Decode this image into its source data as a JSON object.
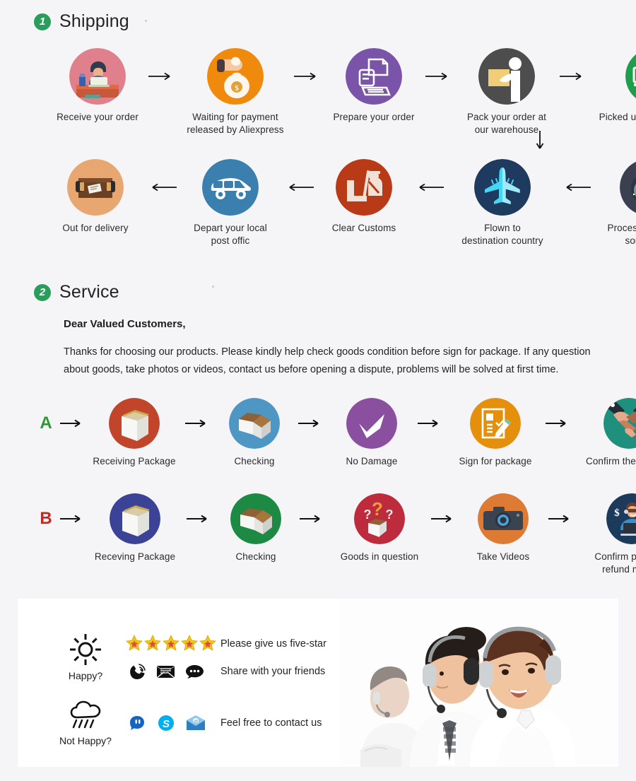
{
  "page": {
    "background": "#f5f4f6",
    "accent_green": "#2a9d5c"
  },
  "sections": [
    {
      "number": "1",
      "title": "Shipping"
    },
    {
      "number": "2",
      "title": "Service"
    }
  ],
  "shipping": {
    "row1": [
      {
        "label": "Receive your order",
        "icon": "desk-worker-icon",
        "color": "#e0808c"
      },
      {
        "label": "Waiting for payment\nreleased by Aliexpress",
        "icon": "money-bag-hand-icon",
        "color": "#ef8a0c"
      },
      {
        "label": "Prepare your order",
        "icon": "printer-icon",
        "color": "#7a54a8"
      },
      {
        "label": "Pack your order at\nour warehouse",
        "icon": "packing-worker-icon",
        "color": "#4d4d4d"
      },
      {
        "label": "Picked up by mail service",
        "icon": "delivery-truck-icon",
        "color": "#1d9e4b"
      }
    ],
    "row2": [
      {
        "label": "Out for delivery",
        "icon": "parcel-box-icon",
        "color": "#e8a671"
      },
      {
        "label": "Depart your local\npost offic",
        "icon": "delivery-van-icon",
        "color": "#3b7fae"
      },
      {
        "label": "Clear  Customs",
        "icon": "customs-officer-icon",
        "color": "#b83a17"
      },
      {
        "label": "Flown to\ndestination country",
        "icon": "airplane-icon",
        "color": "#1f3a5f"
      },
      {
        "label": "Processed through\nsort facility",
        "icon": "sort-facility-icon",
        "color": "#3a4050"
      }
    ],
    "arrow_right": "arrow-right-icon",
    "arrow_left": "arrow-left-icon",
    "arrow_down": "arrow-down-icon"
  },
  "service": {
    "salutation": "Dear Valued Customers,",
    "body": "Thanks for choosing our products. Please kindly help check goods condition before sign for package. If any question about goods, take photos or videos, contact us before opening a dispute, problems will be solved at first time.",
    "rowA": {
      "letter": "A",
      "letter_color": "#2c9a33",
      "steps": [
        {
          "label": "Receiving Package",
          "icon": "sealed-box-icon",
          "color": "#c1452b"
        },
        {
          "label": "Checking",
          "icon": "open-box-icon",
          "color": "#4e96c4"
        },
        {
          "label": "No Damage",
          "icon": "check-mark-icon",
          "color": "#8a4f9e"
        },
        {
          "label": "Sign for package",
          "icon": "sign-document-icon",
          "color": "#e5900d"
        },
        {
          "label": "Confirm the delivery",
          "icon": "handshake-icon",
          "color": "#1f8f7e"
        }
      ]
    },
    "rowB": {
      "letter": "B",
      "letter_color": "#c12a21",
      "steps": [
        {
          "label": "Receving Package",
          "icon": "sealed-box-icon",
          "color": "#3b4397"
        },
        {
          "label": "Checking",
          "icon": "open-box-icon",
          "color": "#1d8a43"
        },
        {
          "label": "Goods in question",
          "icon": "question-box-icon",
          "color": "#bd2b3c"
        },
        {
          "label": "Take Videos",
          "icon": "camera-icon",
          "color": "#dd7a34"
        },
        {
          "label": "Confirm problem,\nrefund money",
          "icon": "support-agent-money-icon",
          "color": "#1b3a5c"
        }
      ]
    }
  },
  "feedback": {
    "happy": {
      "mood_icon": "sun-icon",
      "mood_label": "Happy?",
      "rating_icon": "five-stars-icon",
      "rating_count": 5,
      "rating_text": "Please give us five-star",
      "share_icons": [
        "phone-signal-icon",
        "email-envelope-icon",
        "chat-bubble-icon"
      ],
      "share_text": "Share with your friends"
    },
    "not_happy": {
      "mood_icon": "rain-cloud-icon",
      "mood_label": "Not Happy?",
      "contact_icons": [
        "trademanager-icon",
        "skype-icon",
        "mail-icon"
      ],
      "contact_text": "Feel free to contact us"
    },
    "photo": {
      "name": "customer-service-team-photo",
      "alt": "Three customer service agents wearing headsets"
    }
  }
}
